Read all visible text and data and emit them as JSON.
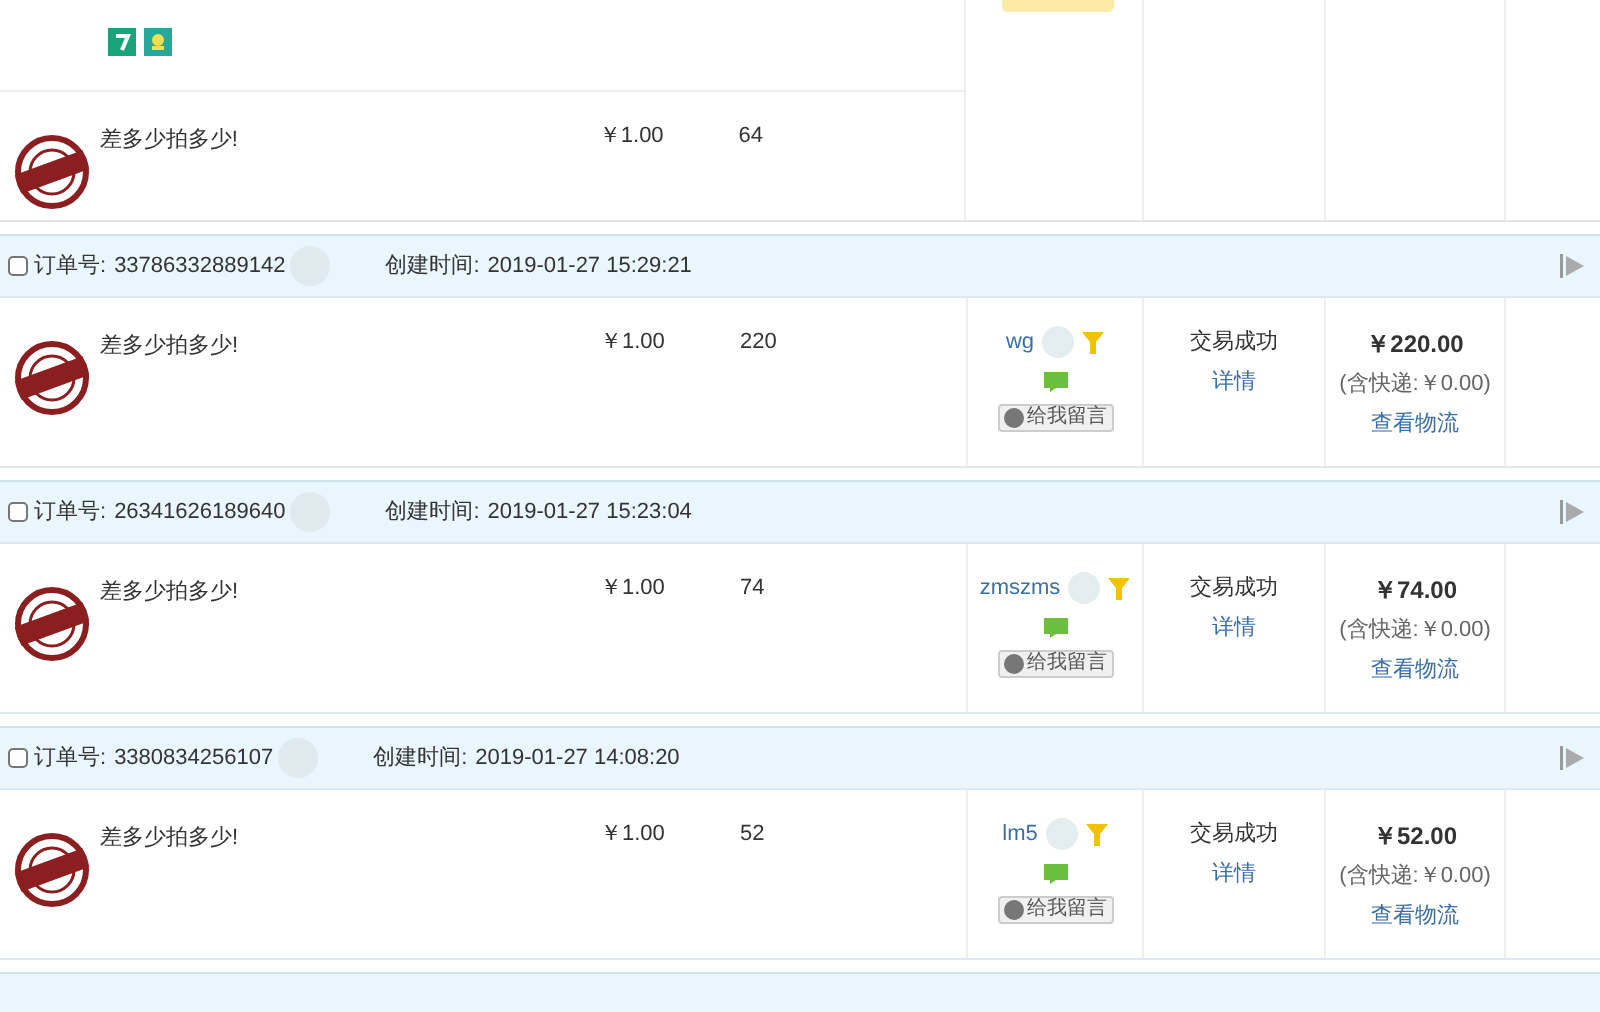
{
  "top_item": {
    "name": "差多少拍多少!",
    "price": "￥1.00",
    "quantity": "64"
  },
  "orders": [
    {
      "selected": false,
      "order_label": "订单号:",
      "order_no": "33786332889142",
      "created_label": "创建时间:",
      "created": "2019-01-27 15:29:21",
      "item": {
        "name": "差多少拍多少!",
        "price": "￥1.00",
        "quantity": "220"
      },
      "buyer": "wg",
      "message_button": "给我留言",
      "status": "交易成功",
      "detail_link": "详情",
      "total": "￥220.00",
      "shipping": "(含快递:￥0.00)",
      "logistics_link": "查看物流"
    },
    {
      "selected": false,
      "order_label": "订单号:",
      "order_no": "26341626189640",
      "created_label": "创建时间:",
      "created": "2019-01-27 15:23:04",
      "item": {
        "name": "差多少拍多少!",
        "price": "￥1.00",
        "quantity": "74"
      },
      "buyer": "zmszms",
      "message_button": "给我留言",
      "status": "交易成功",
      "detail_link": "详情",
      "total": "￥74.00",
      "shipping": "(含快递:￥0.00)",
      "logistics_link": "查看物流"
    },
    {
      "selected": false,
      "order_label": "订单号:",
      "order_no": "3380834256107",
      "created_label": "创建时间:",
      "created": "2019-01-27 14:08:20",
      "item": {
        "name": "差多少拍多少!",
        "price": "￥1.00",
        "quantity": "52"
      },
      "buyer": "lm5",
      "message_button": "给我留言",
      "status": "交易成功",
      "detail_link": "详情",
      "total": "￥52.00",
      "shipping": "(含快递:￥0.00)",
      "logistics_link": "查看物流"
    }
  ]
}
